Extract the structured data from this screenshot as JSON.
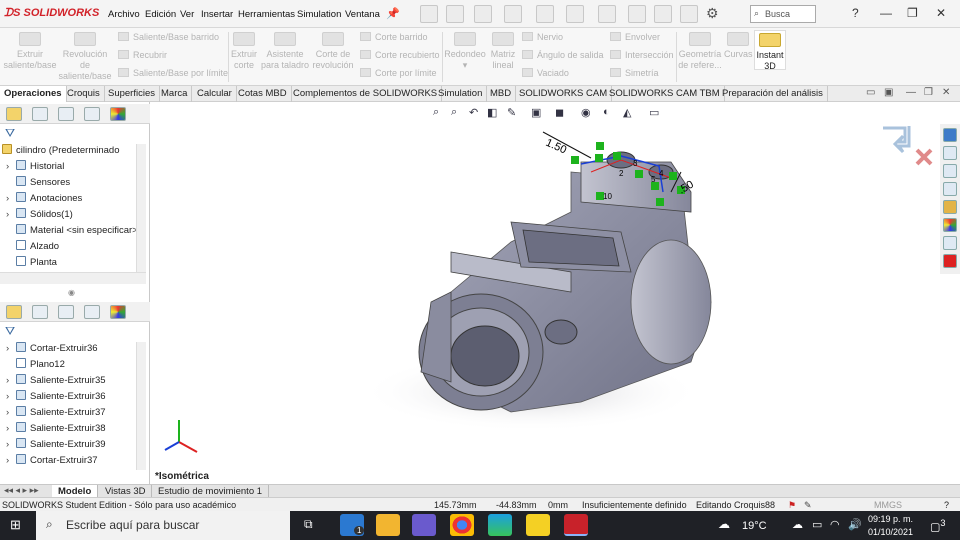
{
  "app": {
    "logo": "SOLIDWORKS"
  },
  "menu": [
    "Archivo",
    "Edición",
    "Ver",
    "Insertar",
    "Herramientas",
    "Simulation",
    "Ventana"
  ],
  "search": {
    "placeholder": "Busca"
  },
  "ribbon": {
    "extrude_boss": "Extruir saliente/base",
    "revolve_boss": "Revolución de saliente/base",
    "swept_boss": "Saliente/Base barrido",
    "lofted_boss": "Recubrir",
    "boundary_boss": "Saliente/Base por límite",
    "extrude_cut": "Extruir corte",
    "hole_wizard": "Asistente para taladro",
    "revolve_cut": "Corte de revolución",
    "swept_cut": "Corte barrido",
    "lofted_cut": "Corte recubierto",
    "boundary_cut": "Corte por límite",
    "fillet": "Redondeo",
    "linear_pattern": "Matriz lineal",
    "rib": "Nervio",
    "draft": "Ángulo de salida",
    "shell": "Vaciado",
    "wrap": "Envolver",
    "intersect": "Intersección",
    "mirror": "Simetría",
    "ref_geometry": "Geometría de refere...",
    "curves": "Curvas",
    "instant3d": "Instant 3D"
  },
  "tabs": [
    "Operaciones",
    "Croquis",
    "Superficies",
    "Marca",
    "Calcular",
    "Cotas MBD",
    "Complementos de SOLIDWORKS",
    "Simulation",
    "MBD",
    "SOLIDWORKS CAM",
    "SOLIDWORKS CAM TBM",
    "Preparación del análisis"
  ],
  "tree_top": {
    "root": "cilindro  (Predeterminado",
    "items": [
      "Historial",
      "Sensores",
      "Anotaciones",
      "Sólidos(1)",
      "Material <sin especificar>",
      "Alzado",
      "Planta"
    ]
  },
  "tree_bottom": {
    "items": [
      "Cortar-Extruir36",
      "Plano12",
      "Saliente-Extruir35",
      "Saliente-Extruir36",
      "Saliente-Extruir37",
      "Saliente-Extruir38",
      "Saliente-Extruir39",
      "Cortar-Extruir37"
    ]
  },
  "viewport": {
    "view_label": "*Isométrica",
    "dim1": "1.50",
    "dim2": ".50",
    "sketch_nums": [
      "2",
      "3",
      "4",
      "5",
      "10"
    ]
  },
  "bottom_tabs": [
    "Modelo",
    "Vistas 3D",
    "Estudio de movimiento 1"
  ],
  "status": {
    "edition": "SOLIDWORKS Student Edition - Sólo para uso académico",
    "x": "145.73mm",
    "y": "-44.83mm",
    "z": "0mm",
    "state": "Insuficientemente definido",
    "editing": "Editando Croquis88",
    "units": "MMGS"
  },
  "taskbar": {
    "search": "Escribe aquí para buscar",
    "temp": "19°C",
    "time": "09:19 p. m.",
    "date": "01/10/2021",
    "mail_badge": "1",
    "notif": "3"
  },
  "colors": {
    "accent": "#d2232a",
    "model": "#8c8ea3",
    "sketch": "#1a3fd6",
    "relation": "#1db31d"
  }
}
